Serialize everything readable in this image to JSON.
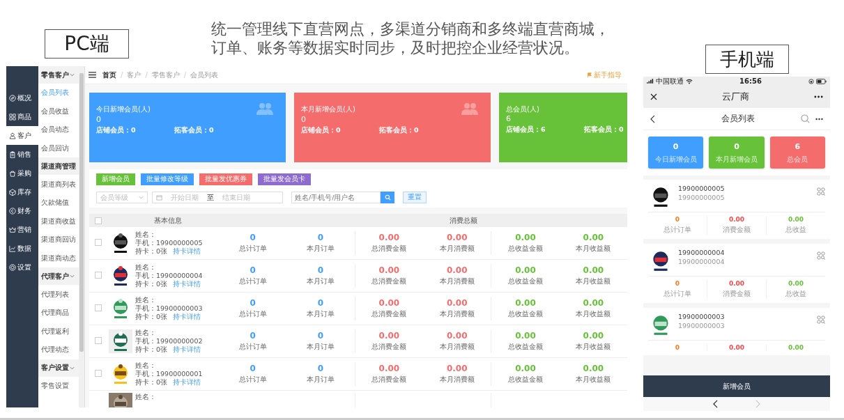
{
  "headline": {
    "lines": [
      "统一管理线下直营网点，多渠道分销商和多终端直营商城，",
      "订单、账务等数据实时同步，及时把控企业经营状况。"
    ]
  },
  "pc_label": "PC端",
  "mobile_label": "手机端",
  "pc": {
    "sidebar": [
      {
        "label": "概况",
        "selected": false
      },
      {
        "label": "商品",
        "selected": false
      },
      {
        "label": "客户",
        "selected": true
      },
      {
        "label": "销售",
        "selected": false
      },
      {
        "label": "采购",
        "selected": false
      },
      {
        "label": "库存",
        "selected": false
      },
      {
        "label": "财务",
        "selected": false
      },
      {
        "label": "营销",
        "selected": false
      },
      {
        "label": "数据",
        "selected": false
      },
      {
        "label": "设置",
        "selected": false
      }
    ],
    "submenu": [
      {
        "label": "零售客户",
        "expanded": true,
        "children": [
          {
            "label": "会员列表",
            "selected": true
          },
          {
            "label": "会员收益",
            "selected": false
          },
          {
            "label": "会员动态",
            "selected": false
          },
          {
            "label": "会员回访",
            "selected": false
          }
        ]
      },
      {
        "label": "渠道商管理",
        "expanded": false,
        "children": [
          {
            "label": "渠道商列表",
            "selected": false
          },
          {
            "label": "欠款储值",
            "selected": false
          },
          {
            "label": "渠道商收益",
            "selected": false
          },
          {
            "label": "渠道商回访",
            "selected": false
          },
          {
            "label": "渠道商动态",
            "selected": false
          }
        ]
      },
      {
        "label": "代理客户",
        "expanded": true,
        "children": [
          {
            "label": "代理列表",
            "selected": false
          },
          {
            "label": "代理商品",
            "selected": false
          },
          {
            "label": "代理返利",
            "selected": false
          },
          {
            "label": "代理动态",
            "selected": false
          }
        ]
      },
      {
        "label": "客户设置",
        "expanded": true,
        "children": [
          {
            "label": "零售设置",
            "selected": false
          }
        ]
      }
    ],
    "breadcrumb": [
      "首页",
      "客户",
      "零售客户",
      "会员列表"
    ],
    "breadcrumb_separators": [
      "/",
      "/",
      "/"
    ],
    "guide_link": "新手指导",
    "cards": [
      {
        "title": "今日新增会员(人)",
        "value": "0",
        "shop_members": "店铺会员：0",
        "new_members": "拓客会员：0",
        "color": "#409eff",
        "icon": true
      },
      {
        "title": "本月新增会员(人)",
        "value": "0",
        "shop_members": "店铺会员：0",
        "new_members": "拓客会员：0",
        "color": "#f56c6c",
        "icon": true
      },
      {
        "title": "总会员(人)",
        "value": "6",
        "shop_members": "店铺会员：6",
        "new_members": "拓客会员：0",
        "color": "#67c23a",
        "icon": false
      }
    ],
    "buttons": [
      {
        "label": "新增会员",
        "color": "#67c23a"
      },
      {
        "label": "批量修改等级",
        "color": "#409eff"
      },
      {
        "label": "批量发优惠券",
        "color": "#f56c6c"
      },
      {
        "label": "批量发会员卡",
        "color": "#8e6ccf"
      }
    ],
    "filters": {
      "level_placeholder": "会员等级",
      "start_placeholder": "开始日期",
      "range_separator": "至",
      "end_placeholder": "结束日期",
      "search_placeholder": "姓名/手机号/用户名",
      "reset": "重置"
    },
    "table": {
      "select_all_checked": false,
      "columns": [
        "基本信息",
        "消费总额"
      ],
      "rows": [
        {
          "checked": false,
          "name_label": "姓名：",
          "phone": "手机：19900000005",
          "cards": "持卡：0张",
          "card_link": "持卡详情",
          "stats": [
            {
              "value": "0",
              "label": "总计订单",
              "kind": "orders"
            },
            {
              "value": "0",
              "label": "本月订单",
              "kind": "orders"
            },
            {
              "value": "0.00",
              "label": "总消费金额",
              "kind": "spend"
            },
            {
              "value": "0.00",
              "label": "本月消费额",
              "kind": "spend"
            },
            {
              "value": "0.00",
              "label": "总收益金额",
              "kind": "income"
            },
            {
              "value": "0.00",
              "label": "本月收益额",
              "kind": "income"
            }
          ]
        },
        {
          "checked": false,
          "name_label": "姓名：",
          "phone": "手机：19900000004",
          "cards": "持卡：0张",
          "card_link": "持卡详情",
          "stats": [
            {
              "value": "0",
              "label": "总计订单",
              "kind": "orders"
            },
            {
              "value": "0",
              "label": "本月订单",
              "kind": "orders"
            },
            {
              "value": "0.00",
              "label": "总消费金额",
              "kind": "spend"
            },
            {
              "value": "0.00",
              "label": "本月消费额",
              "kind": "spend"
            },
            {
              "value": "0.00",
              "label": "总收益金额",
              "kind": "income"
            },
            {
              "value": "0.00",
              "label": "本月收益额",
              "kind": "income"
            }
          ]
        },
        {
          "checked": false,
          "name_label": "姓名：",
          "phone": "手机：19900000003",
          "cards": "持卡：0张",
          "card_link": "持卡详情",
          "stats": [
            {
              "value": "0",
              "label": "总计订单",
              "kind": "orders"
            },
            {
              "value": "0",
              "label": "本月订单",
              "kind": "orders"
            },
            {
              "value": "0.00",
              "label": "总消费金额",
              "kind": "spend"
            },
            {
              "value": "0.00",
              "label": "本月消费额",
              "kind": "spend"
            },
            {
              "value": "0.00",
              "label": "总收益金额",
              "kind": "income"
            },
            {
              "value": "0.00",
              "label": "本月收益额",
              "kind": "income"
            }
          ]
        },
        {
          "checked": false,
          "name_label": "姓名：",
          "phone": "手机：19900000002",
          "cards": "持卡：0张",
          "card_link": "持卡详情",
          "stats": [
            {
              "value": "0",
              "label": "总计订单",
              "kind": "orders"
            },
            {
              "value": "0",
              "label": "本月订单",
              "kind": "orders"
            },
            {
              "value": "0.00",
              "label": "总消费金额",
              "kind": "spend"
            },
            {
              "value": "0.00",
              "label": "本月消费额",
              "kind": "spend"
            },
            {
              "value": "0.00",
              "label": "总收益金额",
              "kind": "income"
            },
            {
              "value": "0.00",
              "label": "本月收益额",
              "kind": "income"
            }
          ]
        },
        {
          "checked": false,
          "name_label": "姓名：",
          "phone": "手机：19900000001",
          "cards": "持卡：0张",
          "card_link": "持卡详情",
          "stats": [
            {
              "value": "0",
              "label": "总计订单",
              "kind": "orders"
            },
            {
              "value": "0",
              "label": "本月订单",
              "kind": "orders"
            },
            {
              "value": "0.00",
              "label": "总消费金额",
              "kind": "spend"
            },
            {
              "value": "0.00",
              "label": "本月消费额",
              "kind": "spend"
            },
            {
              "value": "0.00",
              "label": "总收益金额",
              "kind": "income"
            },
            {
              "value": "0.00",
              "label": "本月收益额",
              "kind": "income"
            }
          ]
        },
        {
          "name_label": "姓名："
        }
      ]
    }
  },
  "mobile": {
    "carrier": "中国联通",
    "time": "16:56",
    "app_title": "云厂商",
    "page_title": "会员列表",
    "stats": [
      {
        "value": "0",
        "label": "今日新增会员",
        "color": "#409eff"
      },
      {
        "value": "0",
        "label": "本月新增会员",
        "color": "#67c23a"
      },
      {
        "value": "6",
        "label": "总会员",
        "color": "#f56c6c"
      }
    ],
    "members": [
      {
        "phone": "19900000005",
        "subtitle": "19900000005",
        "stats": [
          {
            "value": "0",
            "label": "总计订单",
            "kind": "orders"
          },
          {
            "value": "0.00",
            "label": "消费金额",
            "kind": "spend"
          },
          {
            "value": "0.00",
            "label": "总收益",
            "kind": "income"
          }
        ]
      },
      {
        "phone": "19900000004",
        "subtitle": "19900000004",
        "stats": [
          {
            "value": "0",
            "label": "总计订单",
            "kind": "orders"
          },
          {
            "value": "0.00",
            "label": "消费金额",
            "kind": "spend"
          },
          {
            "value": "0.00",
            "label": "总收益",
            "kind": "income"
          }
        ]
      },
      {
        "phone": "19900000003",
        "subtitle": "19900000003",
        "stats": [
          {
            "value": "0",
            "kind": "orders"
          },
          {
            "value": "0.00",
            "kind": "spend"
          },
          {
            "value": "0.00",
            "kind": "income"
          }
        ]
      }
    ],
    "add_button": "新增会员",
    "forward_enabled": false
  }
}
